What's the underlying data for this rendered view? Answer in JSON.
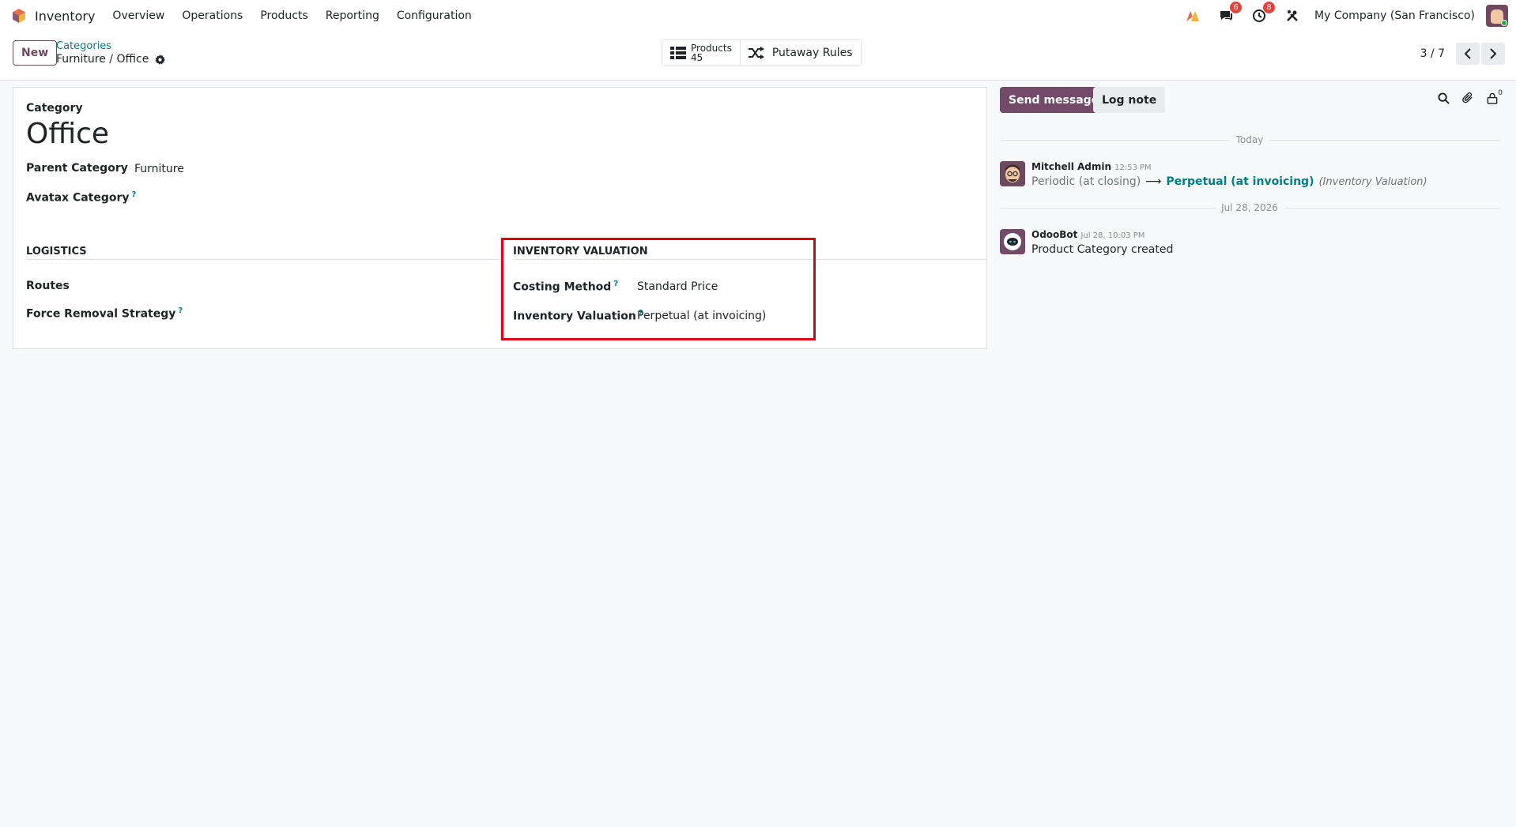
{
  "navbar": {
    "app_name": "Inventory",
    "menu": [
      "Overview",
      "Operations",
      "Products",
      "Reporting",
      "Configuration"
    ],
    "messages_badge": "6",
    "activities_badge": "8",
    "company": "My Company (San Francisco)"
  },
  "control": {
    "new_label": "New",
    "breadcrumb_parent": "Categories",
    "breadcrumb_current": "Furniture / Office",
    "products_label": "Products",
    "products_count": "45",
    "putaway_label": "Putaway Rules",
    "pager": "3 / 7"
  },
  "form": {
    "category_label": "Category",
    "name": "Office",
    "parent_label": "Parent Category",
    "parent_value": "Furniture",
    "avatax_label": "Avatax Category",
    "help_mark": "?",
    "logistics_title": "LOGISTICS",
    "routes_label": "Routes",
    "removal_label": "Force Removal Strategy",
    "valuation_title": "INVENTORY VALUATION",
    "costing_label": "Costing Method",
    "costing_value": "Standard Price",
    "valuation_label": "Inventory Valuation",
    "valuation_value": "Perpetual (at invoicing)"
  },
  "chatter": {
    "send_label": "Send message",
    "log_label": "Log note",
    "followers_count": "0",
    "today": "Today",
    "date2": "Jul 28, 2026",
    "messages": [
      {
        "author": "Mitchell Admin",
        "time": "12:53 PM",
        "old_value": "Periodic (at closing)",
        "arrow": "⟶",
        "new_value": "Perpetual (at invoicing)",
        "field": "(Inventory Valuation)"
      },
      {
        "author": "OdooBot",
        "time": "Jul 28, 10:03 PM",
        "body": "Product Category created"
      }
    ]
  },
  "colors": {
    "primary": "#714b67",
    "link": "#017e84",
    "badge": "#e0463d",
    "highlight": "#e0000e"
  }
}
